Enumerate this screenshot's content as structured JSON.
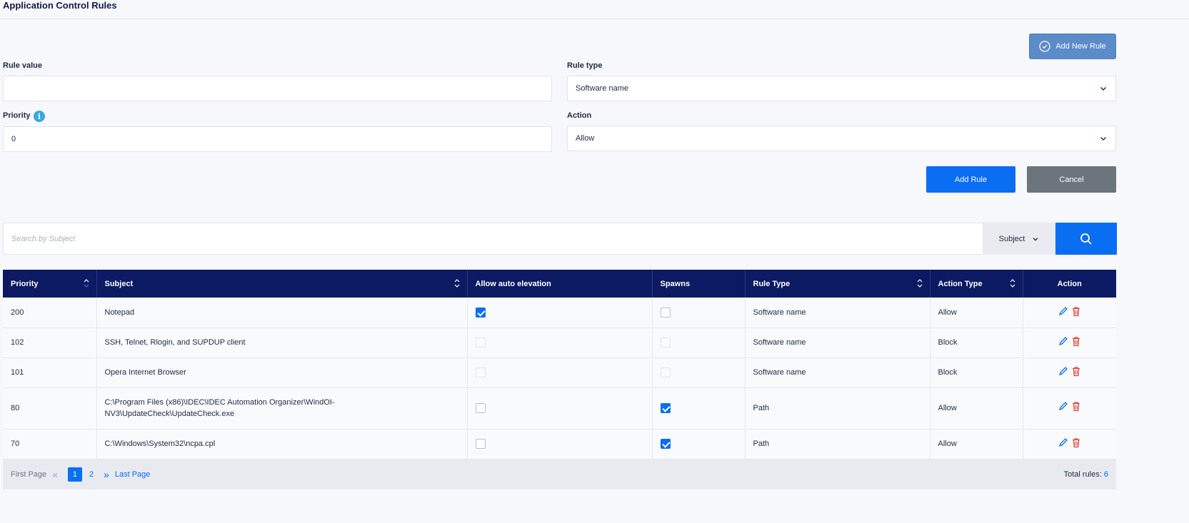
{
  "page": {
    "title": "Application Control Rules"
  },
  "toolbar": {
    "add_new_rule_label": "Add New Rule"
  },
  "form": {
    "rule_value": {
      "label": "Rule value",
      "value": ""
    },
    "rule_type": {
      "label": "Rule type",
      "selected": "Software name"
    },
    "priority": {
      "label": "Priority",
      "value": "0",
      "info_icon": "info-icon"
    },
    "action": {
      "label": "Action",
      "selected": "Allow"
    },
    "add_rule_label": "Add Rule",
    "cancel_label": "Cancel"
  },
  "search": {
    "placeholder": "Search by Subject",
    "field_selected": "Subject"
  },
  "table": {
    "headers": [
      "Priority",
      "Subject",
      "Allow auto elevation",
      "Spawns",
      "Rule Type",
      "Action Type",
      "Action"
    ],
    "rows": [
      {
        "priority": "200",
        "subject": "Notepad",
        "allow_auto_elevation": true,
        "auto_elev_enabled": true,
        "spawns": false,
        "spawns_enabled": true,
        "rule_type": "Software name",
        "action_type": "Allow"
      },
      {
        "priority": "102",
        "subject": "SSH, Telnet, Rlogin, and SUPDUP client",
        "allow_auto_elevation": false,
        "auto_elev_enabled": false,
        "spawns": false,
        "spawns_enabled": false,
        "rule_type": "Software name",
        "action_type": "Block"
      },
      {
        "priority": "101",
        "subject": "Opera Internet Browser",
        "allow_auto_elevation": false,
        "auto_elev_enabled": false,
        "spawns": false,
        "spawns_enabled": false,
        "rule_type": "Software name",
        "action_type": "Block"
      },
      {
        "priority": "80",
        "subject_line1": "C:\\Program Files (x86)\\IDEC\\IDEC Automation Organizer\\WindOI-",
        "subject_line2": "NV3\\UpdateCheck\\UpdateCheck.exe",
        "allow_auto_elevation": false,
        "auto_elev_enabled": true,
        "spawns": true,
        "spawns_enabled": true,
        "rule_type": "Path",
        "action_type": "Allow"
      },
      {
        "priority": "70",
        "subject": "C:\\Windows\\System32\\ncpa.cpl",
        "allow_auto_elevation": false,
        "auto_elev_enabled": true,
        "spawns": true,
        "spawns_enabled": true,
        "rule_type": "Path",
        "action_type": "Allow"
      }
    ]
  },
  "pagination": {
    "first_label": "First Page",
    "pages": [
      "1",
      "2"
    ],
    "current_page": "1",
    "last_label": "Last Page",
    "total_label": "Total rules:",
    "total_value": "6"
  },
  "colors": {
    "accent": "#0a6ef2",
    "header_bg": "#0c1a63",
    "add_new_rule_bg": "#5b8cc9",
    "cancel_bg": "#6c757d",
    "delete_icon": "#e0453c"
  }
}
